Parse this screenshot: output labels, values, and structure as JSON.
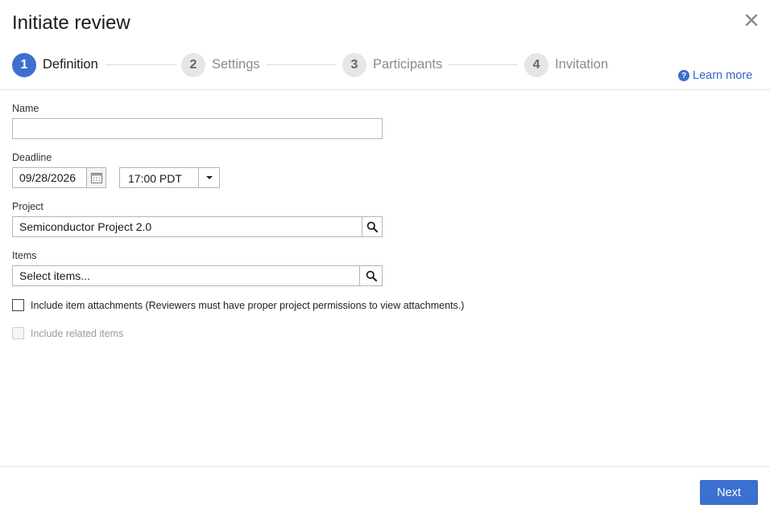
{
  "dialog": {
    "title": "Initiate review",
    "close_label": "Close"
  },
  "stepper": {
    "steps": [
      {
        "number": "1",
        "label": "Definition",
        "state": "active"
      },
      {
        "number": "2",
        "label": "Settings",
        "state": "inactive"
      },
      {
        "number": "3",
        "label": "Participants",
        "state": "inactive"
      },
      {
        "number": "4",
        "label": "Invitation",
        "state": "inactive"
      }
    ]
  },
  "help": {
    "learn_more": "Learn more",
    "icon_glyph": "?"
  },
  "form": {
    "name": {
      "label": "Name",
      "value": ""
    },
    "deadline": {
      "label": "Deadline",
      "date": "09/28/2026",
      "time": "17:00 PDT"
    },
    "project": {
      "label": "Project",
      "value": "Semiconductor Project 2.0"
    },
    "items": {
      "label": "Items",
      "value": "Select items..."
    },
    "include_attachments": {
      "label": "Include item attachments (Reviewers must have proper project permissions to view attachments.)",
      "checked": false
    },
    "include_related": {
      "label": "Include related items",
      "checked": false,
      "disabled": true
    }
  },
  "footer": {
    "next_label": "Next"
  },
  "colors": {
    "accent": "#3b6fd0",
    "link": "#3566c2",
    "inactive_step": "#e6e6e6"
  },
  "icons": {
    "close": "close-icon",
    "help": "help-icon",
    "calendar": "calendar-icon",
    "dropdown": "caret-down-icon",
    "search": "search-icon"
  }
}
